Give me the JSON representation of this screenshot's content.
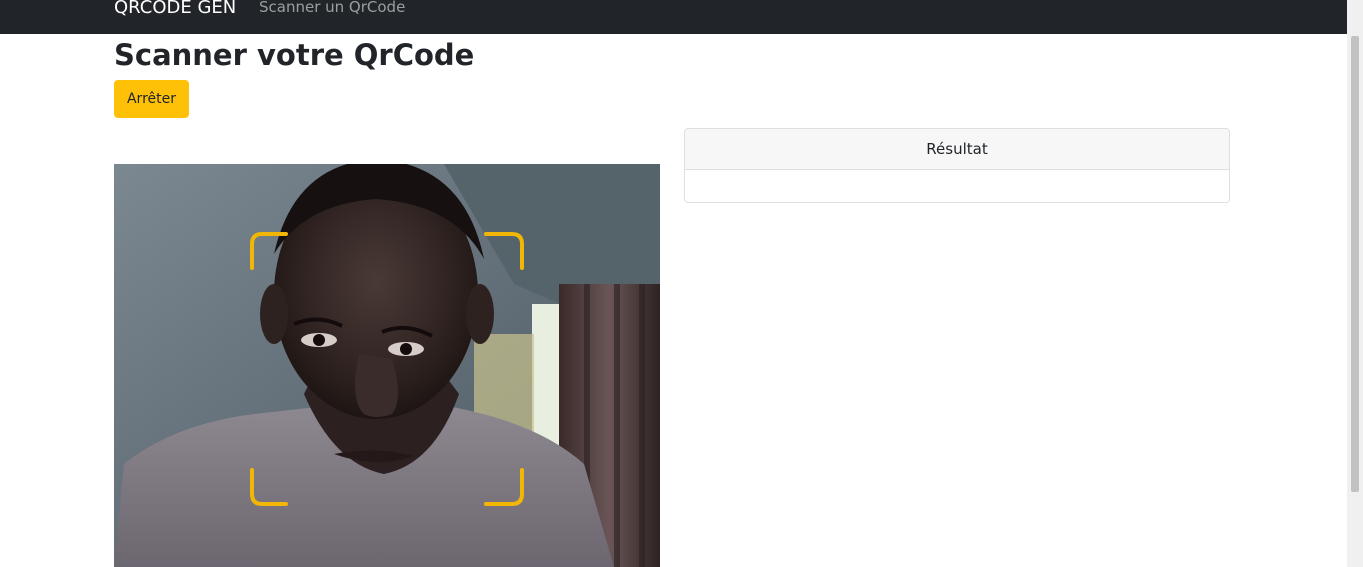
{
  "navbar": {
    "brand": "QRCODE GEN",
    "link": "Scanner un QrCode"
  },
  "main": {
    "title": "Scanner votre QrCode",
    "stop_button": "Arrêter",
    "result_header": "Résultat",
    "result_value": ""
  },
  "colors": {
    "navbar": "#212529",
    "button": "#ffc107",
    "scan_frame": "#f2b705"
  },
  "icons": {
    "scan_frame": "scan-frame-corners-icon"
  }
}
